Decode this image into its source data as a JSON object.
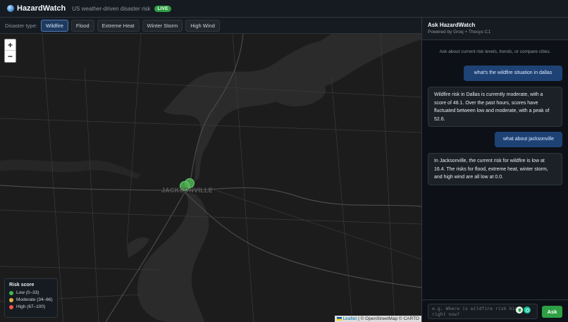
{
  "header": {
    "logo_icon": "globe-icon",
    "title": "HazardWatch",
    "subtitle": "US weather-driven disaster risk",
    "live_badge": "LIVE"
  },
  "filters": {
    "label": "Disaster type:",
    "options": [
      "Wildfire",
      "Flood",
      "Extreme Heat",
      "Winter Storm",
      "High Wind"
    ],
    "active": "Wildfire"
  },
  "map": {
    "zoom_in": "+",
    "zoom_out": "−",
    "city_label": "JACKSONVILLE",
    "markers_color": "#4caf50",
    "legend": {
      "title": "Risk score",
      "items": [
        {
          "label": "Low (0–33)",
          "color": "#3fb950"
        },
        {
          "label": "Moderate (34–66)",
          "color": "#e3b341"
        },
        {
          "label": "High (67–100)",
          "color": "#f85149"
        }
      ]
    },
    "attribution": {
      "leaflet": "Leaflet",
      "rest": "| © OpenStreetMap © CARTO"
    }
  },
  "chat": {
    "title": "Ask HazardWatch",
    "subtitle": "Powered by Groq + Thesys C1",
    "hint": "Ask about current risk levels, trends, or compare cities.",
    "messages": [
      {
        "role": "user",
        "text": "what's the wildfire situation in dallas"
      },
      {
        "role": "assistant",
        "text": "Wildfire risk in Dallas is currently moderate, with a score of 48.1. Over the past hours, scores have fluctuated between low and moderate, with a peak of 52.6."
      },
      {
        "role": "user",
        "text": "what about jacksonville"
      },
      {
        "role": "assistant",
        "text": "In Jacksonville, the current risk for wildfire is low at 16.4. The risks for flood, extreme heat, winter storm, and high wind are all low at 0.0."
      }
    ],
    "input_placeholder": "e.g. Where is wildfire risk highest right now?",
    "ask_label": "Ask"
  },
  "colors": {
    "accent": "#2ea043",
    "active_chip": "#1f3a5f",
    "user_bubble": "#1f4275"
  }
}
